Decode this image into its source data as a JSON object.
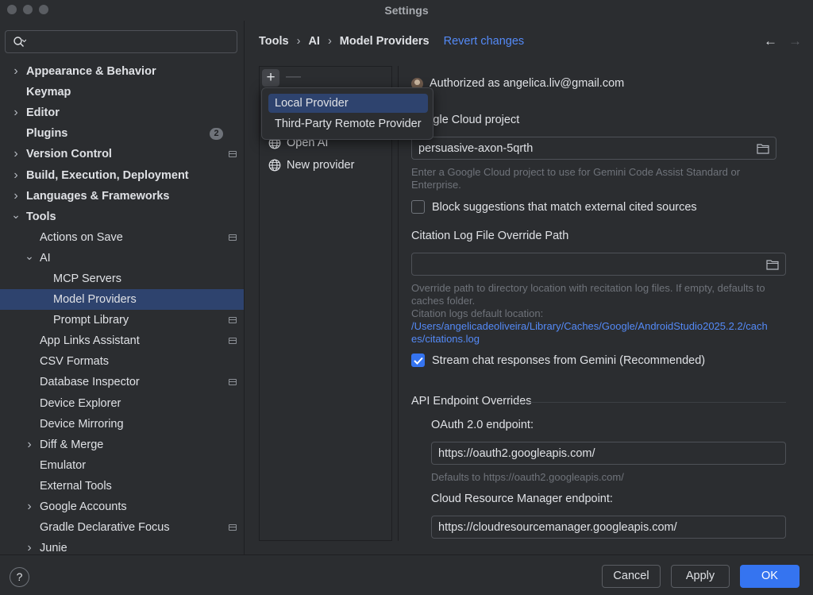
{
  "window": {
    "title": "Settings"
  },
  "search": {
    "placeholder": "",
    "value": ""
  },
  "sidebar": {
    "items": [
      {
        "label": "Appearance & Behavior",
        "indent": 0,
        "expandable": true,
        "expanded": false,
        "bold": true,
        "badge": "",
        "project": false
      },
      {
        "label": "Keymap",
        "indent": 0,
        "expandable": false,
        "bold": true,
        "badge": "",
        "project": false
      },
      {
        "label": "Editor",
        "indent": 0,
        "expandable": true,
        "expanded": false,
        "bold": true,
        "badge": "",
        "project": false
      },
      {
        "label": "Plugins",
        "indent": 0,
        "expandable": false,
        "bold": true,
        "badge": "2",
        "project": false
      },
      {
        "label": "Version Control",
        "indent": 0,
        "expandable": true,
        "expanded": false,
        "bold": true,
        "badge": "",
        "project": true
      },
      {
        "label": "Build, Execution, Deployment",
        "indent": 0,
        "expandable": true,
        "expanded": false,
        "bold": true,
        "badge": "",
        "project": false
      },
      {
        "label": "Languages & Frameworks",
        "indent": 0,
        "expandable": true,
        "expanded": false,
        "bold": true,
        "badge": "",
        "project": false
      },
      {
        "label": "Tools",
        "indent": 0,
        "expandable": true,
        "expanded": true,
        "bold": true,
        "badge": "",
        "project": false
      },
      {
        "label": "Actions on Save",
        "indent": 1,
        "expandable": false,
        "bold": false,
        "badge": "",
        "project": true
      },
      {
        "label": "AI",
        "indent": 1,
        "expandable": true,
        "expanded": true,
        "bold": false,
        "badge": "",
        "project": false
      },
      {
        "label": "MCP Servers",
        "indent": 2,
        "expandable": false,
        "bold": false,
        "badge": "",
        "project": false
      },
      {
        "label": "Model Providers",
        "indent": 2,
        "expandable": false,
        "bold": false,
        "badge": "",
        "project": false,
        "selected": true
      },
      {
        "label": "Prompt Library",
        "indent": 2,
        "expandable": false,
        "bold": false,
        "badge": "",
        "project": true
      },
      {
        "label": "App Links Assistant",
        "indent": 1,
        "expandable": false,
        "bold": false,
        "badge": "",
        "project": true
      },
      {
        "label": "CSV Formats",
        "indent": 1,
        "expandable": false,
        "bold": false,
        "badge": "",
        "project": false
      },
      {
        "label": "Database Inspector",
        "indent": 1,
        "expandable": false,
        "bold": false,
        "badge": "",
        "project": true
      },
      {
        "label": "Device Explorer",
        "indent": 1,
        "expandable": false,
        "bold": false,
        "badge": "",
        "project": false
      },
      {
        "label": "Device Mirroring",
        "indent": 1,
        "expandable": false,
        "bold": false,
        "badge": "",
        "project": false
      },
      {
        "label": "Diff & Merge",
        "indent": 1,
        "expandable": true,
        "expanded": false,
        "bold": false,
        "badge": "",
        "project": false
      },
      {
        "label": "Emulator",
        "indent": 1,
        "expandable": false,
        "bold": false,
        "badge": "",
        "project": false
      },
      {
        "label": "External Tools",
        "indent": 1,
        "expandable": false,
        "bold": false,
        "badge": "",
        "project": false
      },
      {
        "label": "Google Accounts",
        "indent": 1,
        "expandable": true,
        "expanded": false,
        "bold": false,
        "badge": "",
        "project": false
      },
      {
        "label": "Gradle Declarative Focus",
        "indent": 1,
        "expandable": false,
        "bold": false,
        "badge": "",
        "project": true
      },
      {
        "label": "Junie",
        "indent": 1,
        "expandable": true,
        "expanded": false,
        "bold": false,
        "badge": "",
        "project": false
      }
    ]
  },
  "breadcrumb": {
    "part1": "Tools",
    "sep": "›",
    "part2": "AI",
    "part3": "Model Providers",
    "revert": "Revert changes"
  },
  "nav": {
    "back": "←",
    "forward": "→"
  },
  "providers": {
    "add": "+",
    "remove": "—",
    "items": [
      {
        "label": "Open AI",
        "icon": "globe-icon"
      },
      {
        "label": "New provider",
        "icon": "globe-icon"
      }
    ]
  },
  "popup": {
    "items": [
      {
        "label": "Local Provider",
        "active": true
      },
      {
        "label": "Third-Party Remote Provider",
        "active": false
      }
    ]
  },
  "details": {
    "authorized": "Authorized as angelica.liv@gmail.com",
    "project_label": "Google Cloud project",
    "project_value": "persuasive-axon-5qrth",
    "project_hint_1": "Enter a Google Cloud project to use for Gemini Code Assist Standard or",
    "project_hint_2": "Enterprise.",
    "block_label": "Block suggestions that match external cited sources",
    "block_checked": false,
    "citation_label": "Citation Log File Override Path",
    "citation_value": "",
    "citation_hint_1": "Override path to directory location with recitation log files. If empty, defaults to",
    "citation_hint_2": "caches folder.",
    "citation_hint_3": "Citation logs default location:",
    "citation_path_1": "/Users/angelicadeoliveira/Library/Caches/Google/AndroidStudio2025.2.2/cach",
    "citation_path_2": "es/citations.log",
    "stream_label": "Stream chat responses from Gemini (Recommended)",
    "stream_checked": true,
    "api_section": "API Endpoint Overrides",
    "oauth_label": "OAuth 2.0 endpoint:",
    "oauth_value": "https://oauth2.googleapis.com/",
    "oauth_hint": "Defaults to https://oauth2.googleapis.com/",
    "crm_label": "Cloud Resource Manager endpoint:",
    "crm_value": "https://cloudresourcemanager.googleapis.com/"
  },
  "footer": {
    "help": "?",
    "cancel": "Cancel",
    "apply": "Apply",
    "ok": "OK"
  },
  "colors": {
    "accent": "#3574f0",
    "selection": "#2e436e",
    "link": "#548af7",
    "background": "#2b2d30"
  }
}
